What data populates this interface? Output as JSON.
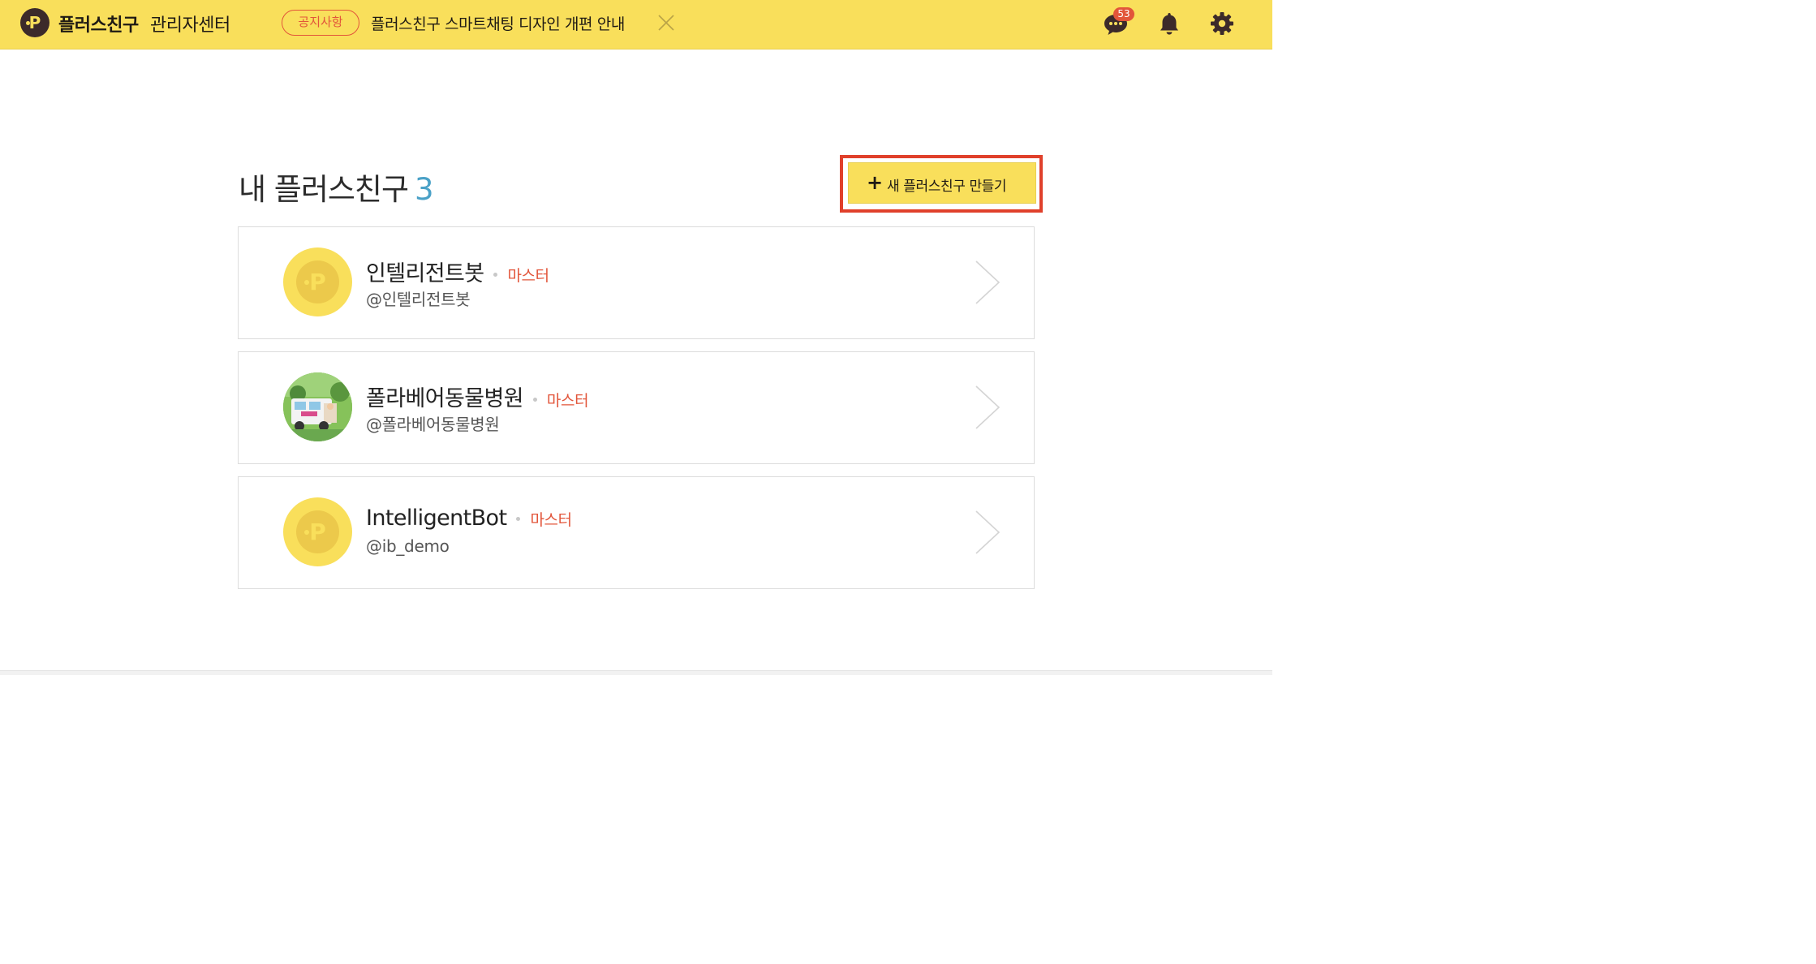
{
  "header": {
    "brand": "플러스친구",
    "brand_sub": "관리자센터",
    "notice_badge": "공지사항",
    "notice_text": "플러스친구 스마트채팅 디자인 개편 안내",
    "chat_count": "53",
    "icons": [
      "logo-icon",
      "close-icon",
      "chat-icon",
      "bell-icon",
      "gear-icon"
    ],
    "colors": {
      "bar": "#f9df5b",
      "badge": "#e2553a"
    }
  },
  "main": {
    "title": "내 플러스친구",
    "count": "3",
    "create_button": "새 플러스친구 만들기",
    "accounts": [
      {
        "name": "인텔리전트봇",
        "role": "마스터",
        "handle": "@인텔리전트봇",
        "avatar": "default-logo"
      },
      {
        "name": "폴라베어동물병원",
        "role": "마스터",
        "handle": "@폴라베어동물병원",
        "avatar": "photo"
      },
      {
        "name": "IntelligentBot",
        "role": "마스터",
        "handle": "@ib_demo",
        "avatar": "default-logo"
      }
    ]
  }
}
